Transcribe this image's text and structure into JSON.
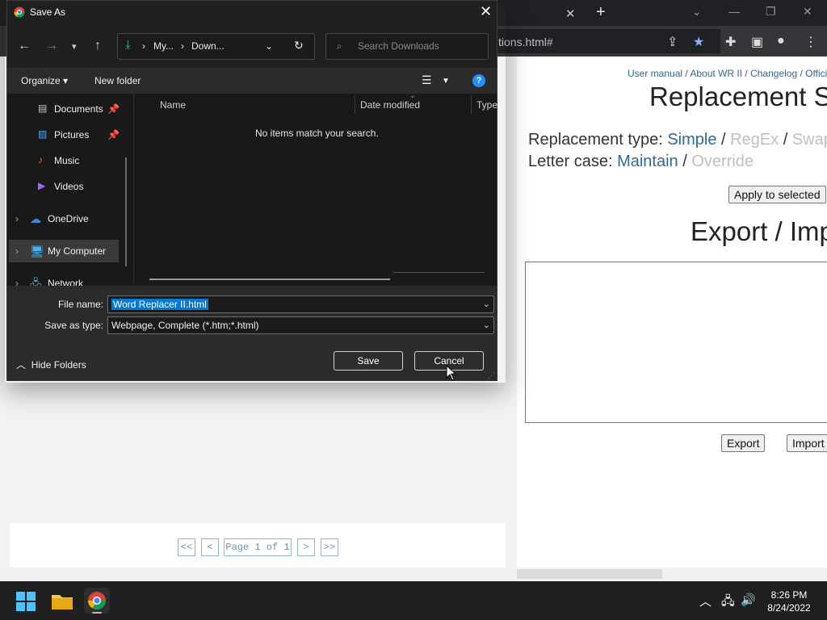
{
  "browser": {
    "url_partial": "tions.html#",
    "tab_close": "✕",
    "new_tab": "+",
    "window_controls": [
      "⌄",
      "—",
      "❐",
      "✕"
    ]
  },
  "page": {
    "links": [
      "User manual",
      "About WR II",
      "Changelog",
      "Offici"
    ],
    "title": "Replacement S",
    "replacement_type_label": "Replacement type:",
    "replacement_types": [
      "Simple",
      "RegEx",
      "Swap"
    ],
    "letter_case_label": "Letter case:",
    "letter_cases": [
      "Maintain",
      "Override"
    ],
    "apply_button": "Apply to selected",
    "export_title": "Export / Imp",
    "export_button": "Export",
    "import_button": "Import",
    "pager": {
      "first": "<<",
      "prev": "<",
      "page_text": "Page 1 of 1",
      "next": ">",
      "last": ">>"
    }
  },
  "dialog": {
    "title": "Save As",
    "address_parts": [
      "My...",
      "Down..."
    ],
    "search_placeholder": "Search Downloads",
    "organize_label": "Organize",
    "new_folder_label": "New folder",
    "nav_items": [
      {
        "label": "Documents",
        "icon": "documents-icon",
        "pinned": true
      },
      {
        "label": "Pictures",
        "icon": "pictures-icon",
        "pinned": true
      },
      {
        "label": "Music",
        "icon": "music-icon",
        "pinned": false
      },
      {
        "label": "Videos",
        "icon": "videos-icon",
        "pinned": false
      },
      {
        "label": "OneDrive",
        "icon": "onedrive-icon",
        "pinned": false
      },
      {
        "label": "My Computer",
        "icon": "computer-icon",
        "pinned": false
      },
      {
        "label": "Network",
        "icon": "network-icon",
        "pinned": false
      }
    ],
    "selected_nav": "My Computer",
    "columns": [
      "Name",
      "Date modified",
      "Type"
    ],
    "empty_message": "No items match your search.",
    "file_name_label": "File name:",
    "file_name_value": "Word Replacer II.html",
    "save_type_label": "Save as type:",
    "save_type_value": "Webpage, Complete (*.htm;*.html)",
    "hide_folders_label": "Hide Folders",
    "save_label": "Save",
    "cancel_label": "Cancel",
    "accent_color": "#0078d4"
  },
  "taskbar": {
    "time": "8:26 PM",
    "date": "8/24/2022"
  }
}
